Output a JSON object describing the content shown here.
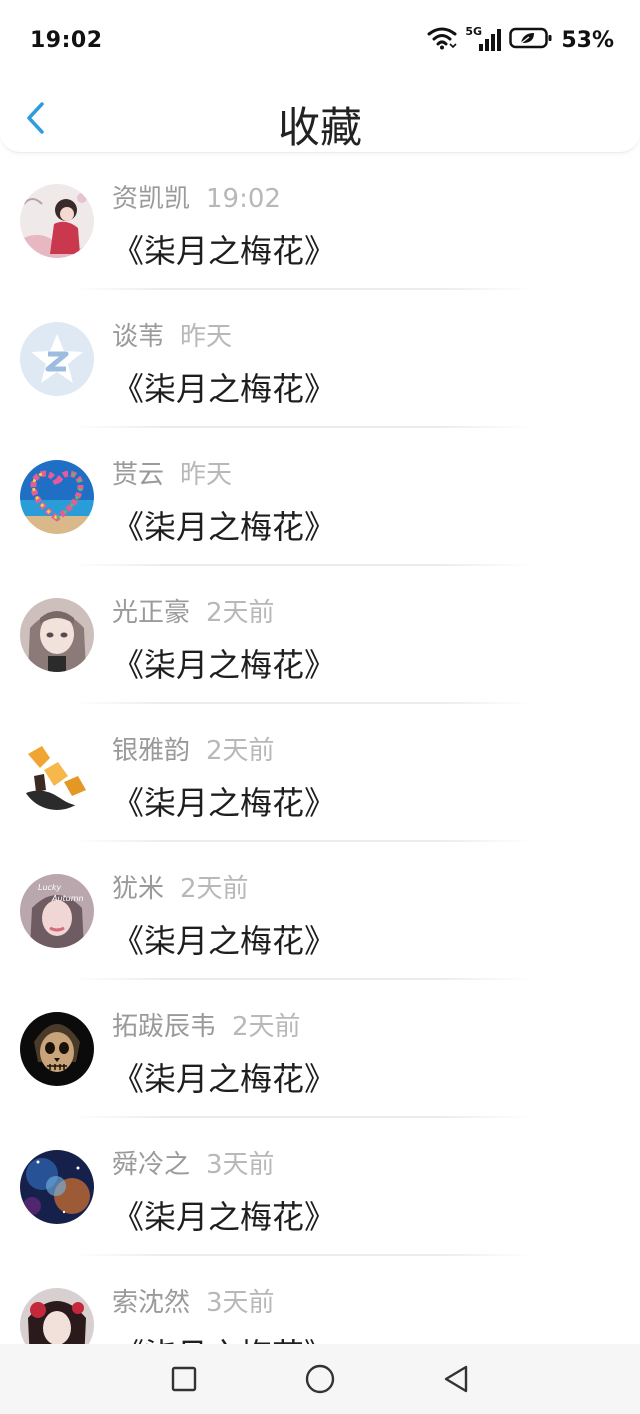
{
  "status_bar": {
    "time": "19:02",
    "network": "5G",
    "battery": "53%",
    "icons": [
      "wifi-icon",
      "signal-5g-icon",
      "battery-icon"
    ]
  },
  "header": {
    "title": "收藏",
    "back_icon": "chevron-left-icon",
    "accent": "#2e9de0"
  },
  "favorites": [
    {
      "name": "资凯凯",
      "time": "19:02",
      "song": "《柒月之梅花》",
      "avatar": "anime-painting"
    },
    {
      "name": "谈苇",
      "time": "昨天",
      "song": "《柒月之梅花》",
      "avatar": "default-qq"
    },
    {
      "name": "贳云",
      "time": "昨天",
      "song": "《柒月之梅花》",
      "avatar": "heart-beach"
    },
    {
      "name": "光正豪",
      "time": "2天前",
      "song": "《柒月之梅花》",
      "avatar": "anime-girl"
    },
    {
      "name": "银雅韵",
      "time": "2天前",
      "song": "《柒月之梅花》",
      "avatar": "amber-crystal"
    },
    {
      "name": "犹米",
      "time": "2天前",
      "song": "《柒月之梅花》",
      "avatar": "lucky-autumn",
      "avatar_text": "Lucky Autumn"
    },
    {
      "name": "拓跋辰韦",
      "time": "2天前",
      "song": "《柒月之梅花》",
      "avatar": "skull"
    },
    {
      "name": "舜冷之",
      "time": "3天前",
      "song": "《柒月之梅花》",
      "avatar": "galaxy"
    },
    {
      "name": "索沈然",
      "time": "3天前",
      "song": "《柒月之梅花》",
      "avatar": "red-portrait"
    }
  ],
  "nav_bar": {
    "buttons": [
      "recent-apps-icon",
      "home-icon",
      "back-icon"
    ]
  }
}
